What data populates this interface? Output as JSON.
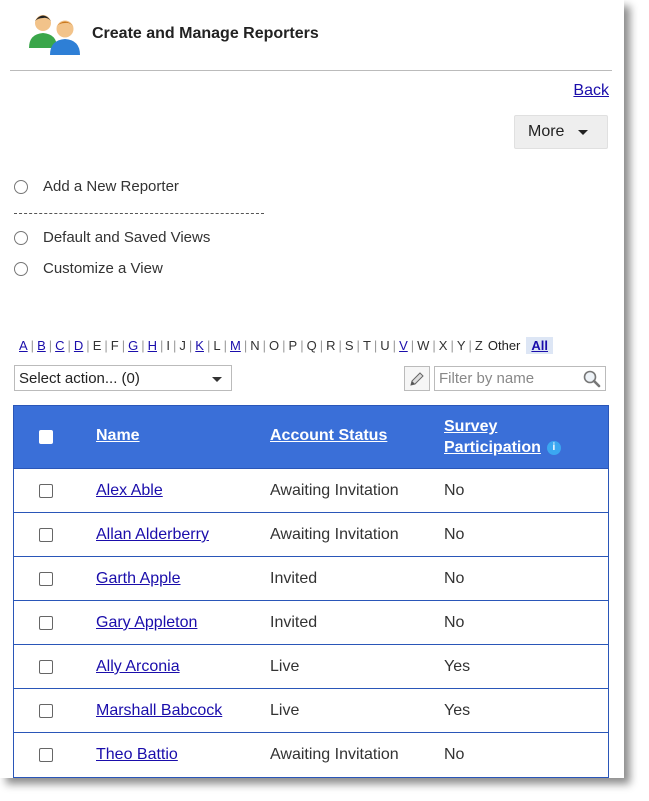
{
  "header": {
    "title": "Create and Manage Reporters",
    "icon": "users-icon"
  },
  "nav": {
    "back_label": "Back",
    "more_label": "More"
  },
  "options": [
    {
      "label": "Add a New Reporter"
    },
    {
      "label": "Default and Saved Views"
    },
    {
      "label": "Customize a View"
    }
  ],
  "alphabet": {
    "letters": [
      "A",
      "B",
      "C",
      "D",
      "E",
      "F",
      "G",
      "H",
      "I",
      "J",
      "K",
      "L",
      "M",
      "N",
      "O",
      "P",
      "Q",
      "R",
      "S",
      "T",
      "U",
      "V",
      "W",
      "X",
      "Y",
      "Z"
    ],
    "linked": [
      "A",
      "B",
      "C",
      "D",
      "G",
      "H",
      "K",
      "M",
      "V"
    ],
    "other_label": "Other",
    "all_label": "All"
  },
  "toolbar": {
    "select_action_label": "Select action... (0)",
    "filter_placeholder": "Filter by name"
  },
  "table": {
    "headers": {
      "name": "Name",
      "status": "Account Status",
      "survey_line1": "Survey",
      "survey_line2": "Participation",
      "info": "i"
    },
    "rows": [
      {
        "name": "Alex Able",
        "status": "Awaiting Invitation",
        "survey": "No"
      },
      {
        "name": "Allan Alderberry",
        "status": "Awaiting Invitation",
        "survey": "No"
      },
      {
        "name": "Garth Apple",
        "status": "Invited",
        "survey": "No"
      },
      {
        "name": "Gary Appleton",
        "status": "Invited",
        "survey": "No"
      },
      {
        "name": "Ally Arconia",
        "status": "Live",
        "survey": "Yes"
      },
      {
        "name": "Marshall Babcock",
        "status": "Live",
        "survey": "Yes"
      },
      {
        "name": "Theo Battio",
        "status": "Awaiting Invitation",
        "survey": "No"
      }
    ]
  },
  "colors": {
    "header_bg": "#3a6fd8",
    "link": "#1a0dab",
    "info": "#3ba7f1"
  }
}
